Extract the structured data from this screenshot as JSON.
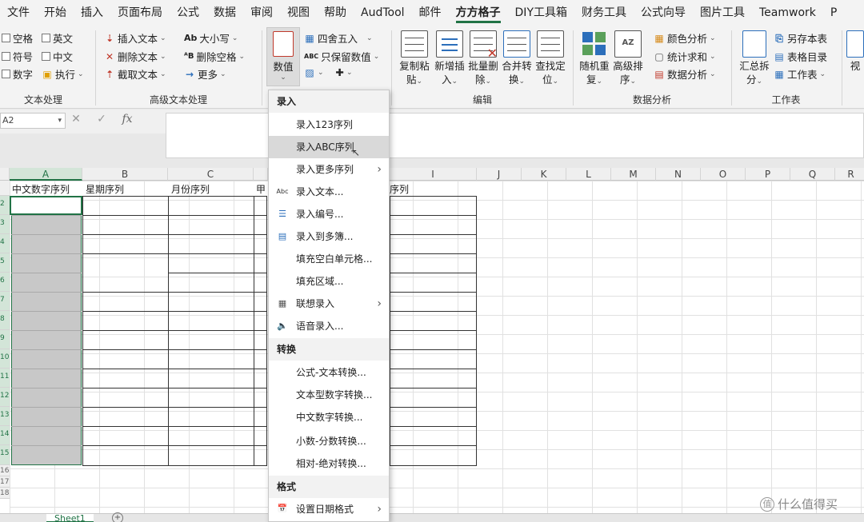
{
  "menubar": {
    "tabs": [
      "文件",
      "开始",
      "插入",
      "页面布局",
      "公式",
      "数据",
      "审阅",
      "视图",
      "帮助",
      "AudTool",
      "邮件",
      "方方格子",
      "DIY工具箱",
      "财务工具",
      "公式向导",
      "图片工具",
      "Teamwork",
      "P"
    ],
    "active": "方方格子"
  },
  "ribbon": {
    "text_group": {
      "items": [
        "空格",
        "英文",
        "符号",
        "中文",
        "数字",
        "执行"
      ],
      "label": "文本处理"
    },
    "advanced_text_group": {
      "insert_text": "插入文本",
      "delete_text": "删除文本",
      "cut_text": "截取文本",
      "case": "大小写",
      "delete_space": "删除空格",
      "more": "更多",
      "case_icon": "Ab",
      "space_icon": "ᴬB",
      "label": "高级文本处理"
    },
    "value_group": {
      "value_button": "数值",
      "round": "四舍五入",
      "keep_value": "只保留数值",
      "keep_icon": "ABC"
    },
    "edit_group": {
      "buttons": [
        {
          "line1": "复制粘",
          "line2": "贴"
        },
        {
          "line1": "新增插",
          "line2": "入"
        },
        {
          "line1": "批量删",
          "line2": "除"
        },
        {
          "line1": "合并转",
          "line2": "换"
        },
        {
          "line1": "查找定",
          "line2": "位"
        }
      ],
      "label": "编辑"
    },
    "analysis_group": {
      "random": {
        "line1": "随机重",
        "line2": "复"
      },
      "sort": {
        "line1": "高级排",
        "line2": "序"
      },
      "sort_icon": "AZ",
      "color_analysis": "颜色分析",
      "stat_sum": "统计求和",
      "data_analysis": "数据分析",
      "label": "数据分析"
    },
    "sheet_group": {
      "summary": {
        "line1": "汇总拆",
        "line2": "分"
      },
      "save_as": "另存本表",
      "table_index": "表格目录",
      "worksheet": "工作表",
      "label": "工作表"
    },
    "view_partial": "视"
  },
  "formulabar": {
    "namebox": "A2",
    "cancel": "✕",
    "confirm": "✓",
    "fx": "fx"
  },
  "sheet": {
    "columns": [
      "A",
      "B",
      "C",
      "I",
      "J",
      "K",
      "L",
      "M",
      "N",
      "O",
      "P",
      "Q",
      "R"
    ],
    "rows": [
      "2",
      "3",
      "4",
      "5",
      "6",
      "7",
      "8",
      "9",
      "10",
      "11",
      "12",
      "13",
      "14",
      "15",
      "16",
      "17",
      "18"
    ],
    "headers": {
      "a1": "中文数字序列",
      "b1": "星期序列",
      "c1": "月份序列",
      "d1_partial": "甲",
      "i1_partial": "序列"
    },
    "tab_name": "Sheet1",
    "add_sheet": "+"
  },
  "dropdown": {
    "section_input": "录入",
    "input_items": [
      {
        "label": "录入123序列",
        "icon": "",
        "arrow": false
      },
      {
        "label": "录入ABC序列",
        "icon": "",
        "arrow": false,
        "hover": true
      },
      {
        "label": "录入更多序列",
        "icon": "",
        "arrow": true
      },
      {
        "label": "录入文本...",
        "icon": "Abc",
        "arrow": false
      },
      {
        "label": "录入编号...",
        "icon": "☰",
        "arrow": false
      },
      {
        "label": "录入到多簿...",
        "icon": "▤",
        "arrow": false
      },
      {
        "label": "填充空白单元格...",
        "icon": "",
        "arrow": false
      },
      {
        "label": "填充区域...",
        "icon": "",
        "arrow": false
      },
      {
        "label": "联想录入",
        "icon": "▦",
        "arrow": true
      },
      {
        "label": "语音录入...",
        "icon": "🔈",
        "arrow": false
      }
    ],
    "section_convert": "转换",
    "convert_items": [
      {
        "label": "公式-文本转换...",
        "arrow": false
      },
      {
        "label": "文本型数字转换...",
        "arrow": false
      },
      {
        "label": "中文数字转换...",
        "arrow": false
      },
      {
        "label": "小数-分数转换...",
        "arrow": false
      },
      {
        "label": "相对-绝对转换...",
        "arrow": false
      }
    ],
    "section_format": "格式",
    "format_items": [
      {
        "label": "设置日期格式",
        "icon": "📅",
        "arrow": true
      }
    ]
  },
  "watermark": {
    "badge": "值",
    "text": "什么值得买"
  },
  "colors": {
    "accent": "#217346",
    "hover": "#d9d9d9",
    "selected_fill": "#c8c8c8"
  }
}
